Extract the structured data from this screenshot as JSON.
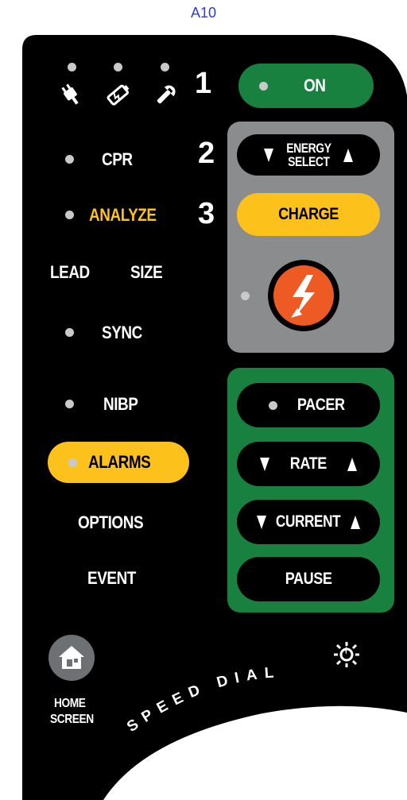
{
  "figure_label": "A10",
  "colors": {
    "panel": "#000000",
    "green": "#19813f",
    "gray_group": "#8a8c8e",
    "yellow": "#fcc21b",
    "orange": "#ee5a24",
    "led": "#c8c9c9",
    "home_icon_bg": "#6e7174"
  },
  "status_icons": [
    "ac-plug-icon",
    "battery-icon",
    "wrench-icon"
  ],
  "steps": {
    "one": "1",
    "two": "2",
    "three": "3"
  },
  "buttons": {
    "on": "ON",
    "energy_line1": "ENERGY",
    "energy_line2": "SELECT",
    "charge": "CHARGE",
    "shock_icon": "lightning-shock-icon",
    "pacer": "PACER",
    "rate": "RATE",
    "current": "CURRENT",
    "pause": "PAUSE"
  },
  "left_menu": {
    "cpr": "CPR",
    "analyze": "ANALYZE",
    "lead": "LEAD",
    "size": "SIZE",
    "sync": "SYNC",
    "nibp": "NIBP",
    "alarms": "ALARMS",
    "options": "OPTIONS",
    "event": "EVENT"
  },
  "home": {
    "icon": "house-icon",
    "line1": "HOME",
    "line2": "SCREEN"
  },
  "brightness_icon": "brightness-sun-icon",
  "speed_dial": "SPEED DIAL"
}
